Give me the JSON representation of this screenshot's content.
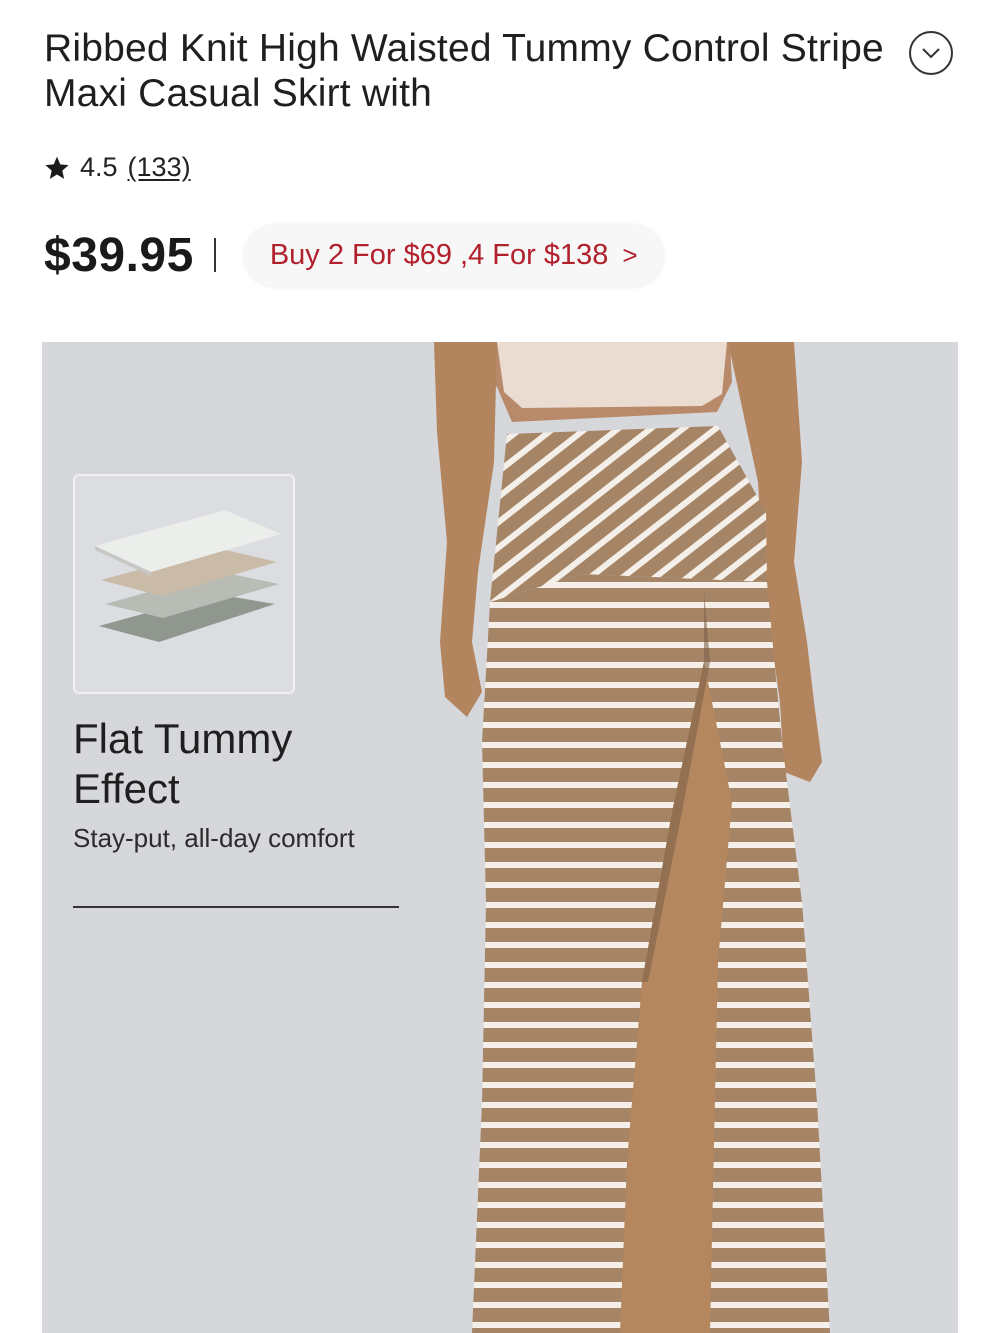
{
  "product": {
    "title": "Ribbed Knit High Waisted Tummy Control Stripe Maxi Casual Skirt with",
    "rating": "4.5",
    "review_count": "(133)",
    "price": "$39.95",
    "promo": "Buy 2 For $69 ,4 For $138",
    "promo_chevron": ">"
  },
  "icons": {
    "expand": "chevron-down-icon",
    "rating": "star-icon",
    "promo": "chevron-right-icon"
  },
  "feature": {
    "title": "Flat Tummy Effect",
    "subtitle": "Stay-put, all-day comfort"
  },
  "colors": {
    "promo_text": "#b1202c",
    "skirt": "#a68566",
    "hero_bg": "#d6d7db"
  }
}
